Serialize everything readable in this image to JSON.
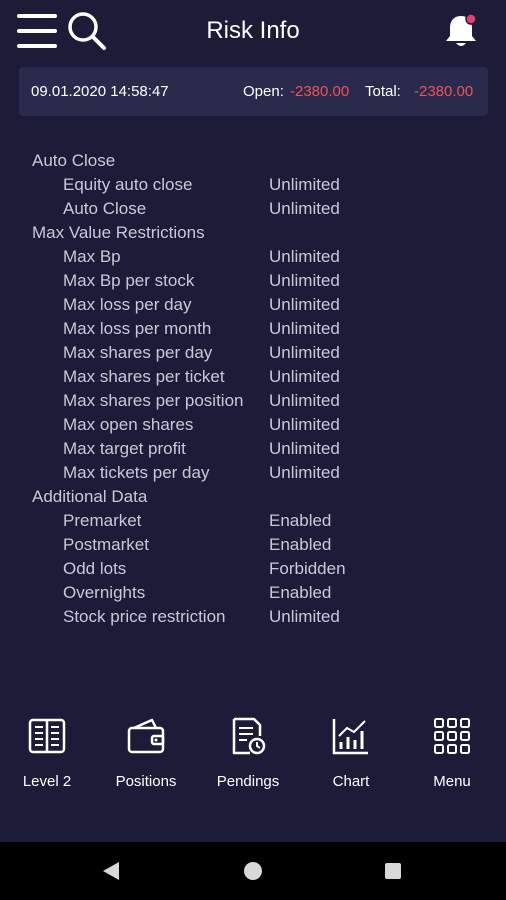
{
  "header": {
    "title": "Risk Info",
    "menu_icon": "hamburger-menu-icon",
    "search_icon": "search-icon",
    "bell_icon": "bell-icon",
    "notification_dot_color": "#e8406a"
  },
  "summary": {
    "datetime": "09.01.2020 14:58:47",
    "open_label": "Open:",
    "open_value": "-2380.00",
    "total_label": "Total:",
    "total_value": "-2380.00",
    "negative_color": "#ef5060"
  },
  "sections": [
    {
      "title": "Auto Close",
      "rows": [
        {
          "key": "Equity auto close",
          "value": "Unlimited"
        },
        {
          "key": "Auto Close",
          "value": "Unlimited"
        }
      ]
    },
    {
      "title": "Max Value Restrictions",
      "rows": [
        {
          "key": "Max Bp",
          "value": "Unlimited"
        },
        {
          "key": "Max Bp per stock",
          "value": "Unlimited"
        },
        {
          "key": "Max loss per day",
          "value": "Unlimited"
        },
        {
          "key": "Max loss per month",
          "value": "Unlimited"
        },
        {
          "key": "Max shares per day",
          "value": "Unlimited"
        },
        {
          "key": "Max shares per ticket",
          "value": "Unlimited"
        },
        {
          "key": "Max shares per position",
          "value": "Unlimited"
        },
        {
          "key": "Max open shares",
          "value": "Unlimited"
        },
        {
          "key": "Max target profit",
          "value": "Unlimited"
        },
        {
          "key": "Max tickets per day",
          "value": "Unlimited"
        }
      ]
    },
    {
      "title": "Additional Data",
      "rows": [
        {
          "key": "Premarket",
          "value": "Enabled"
        },
        {
          "key": "Postmarket",
          "value": "Enabled"
        },
        {
          "key": "Odd lots",
          "value": "Forbidden"
        },
        {
          "key": "Overnights",
          "value": "Enabled"
        },
        {
          "key": "Stock price restriction",
          "value": "Unlimited"
        }
      ]
    }
  ],
  "bottom_nav": [
    {
      "label": "Level 2",
      "icon": "level2-book-icon"
    },
    {
      "label": "Positions",
      "icon": "wallet-icon"
    },
    {
      "label": "Pendings",
      "icon": "pending-document-icon"
    },
    {
      "label": "Chart",
      "icon": "bar-chart-icon"
    },
    {
      "label": "Menu",
      "icon": "grid-menu-icon"
    }
  ],
  "system_nav": {
    "back_icon": "back-triangle-icon",
    "home_icon": "home-circle-icon",
    "recents_icon": "recents-square-icon"
  },
  "colors": {
    "background": "#1d1c38",
    "panel": "#2a2b4c",
    "text": "#c9c9d6"
  }
}
